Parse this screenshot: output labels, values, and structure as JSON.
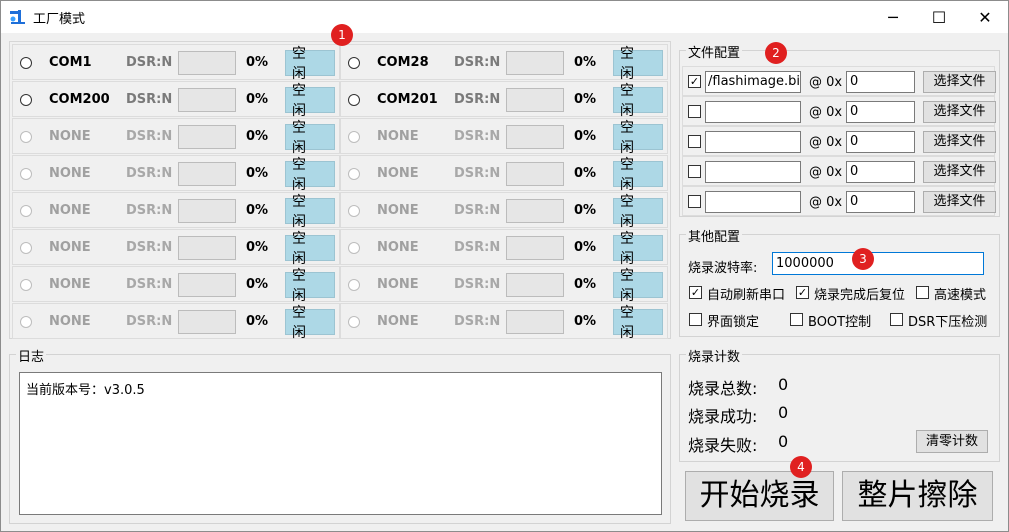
{
  "window": {
    "title": "工厂模式",
    "minimize": "─",
    "maximize": "☐",
    "close": "✕"
  },
  "ports": {
    "dsr_label": "DSR:N",
    "percent": "0%",
    "idle_label": "空 闲",
    "rows": [
      [
        {
          "name": "COM1",
          "enabled": true
        },
        {
          "name": "COM28",
          "enabled": true
        }
      ],
      [
        {
          "name": "COM200",
          "enabled": true
        },
        {
          "name": "COM201",
          "enabled": true
        }
      ],
      [
        {
          "name": "NONE",
          "enabled": false
        },
        {
          "name": "NONE",
          "enabled": false
        }
      ],
      [
        {
          "name": "NONE",
          "enabled": false
        },
        {
          "name": "NONE",
          "enabled": false
        }
      ],
      [
        {
          "name": "NONE",
          "enabled": false
        },
        {
          "name": "NONE",
          "enabled": false
        }
      ],
      [
        {
          "name": "NONE",
          "enabled": false
        },
        {
          "name": "NONE",
          "enabled": false
        }
      ],
      [
        {
          "name": "NONE",
          "enabled": false
        },
        {
          "name": "NONE",
          "enabled": false
        }
      ],
      [
        {
          "name": "NONE",
          "enabled": false
        },
        {
          "name": "NONE",
          "enabled": false
        }
      ]
    ]
  },
  "file_config": {
    "title": "文件配置",
    "at_label": "@ 0x",
    "choose_label": "选择文件",
    "files": [
      {
        "checked": true,
        "path": "/flashimage.bin",
        "addr": "0"
      },
      {
        "checked": false,
        "path": "",
        "addr": "0"
      },
      {
        "checked": false,
        "path": "",
        "addr": "0"
      },
      {
        "checked": false,
        "path": "",
        "addr": "0"
      },
      {
        "checked": false,
        "path": "",
        "addr": "0"
      }
    ]
  },
  "other_config": {
    "title": "其他配置",
    "baud_label": "烧录波特率:",
    "baud_value": "1000000",
    "options": {
      "auto_refresh": {
        "label": "自动刷新串口",
        "checked": true
      },
      "reset_after": {
        "label": "烧录完成后复位",
        "checked": true
      },
      "high_speed": {
        "label": "高速模式",
        "checked": false
      },
      "lock_ui": {
        "label": "界面锁定",
        "checked": false
      },
      "boot_ctrl": {
        "label": "BOOT控制",
        "checked": false
      },
      "dsr_detect": {
        "label": "DSR下压检测",
        "checked": false
      }
    }
  },
  "log": {
    "title": "日志",
    "text": "当前版本号：v3.0.5"
  },
  "stats": {
    "title": "烧录计数",
    "total_label": "烧录总数:",
    "total": "0",
    "success_label": "烧录成功:",
    "success": "0",
    "fail_label": "烧录失败:",
    "fail": "0",
    "clear_label": "清零计数"
  },
  "actions": {
    "start_label": "开始烧录",
    "erase_label": "整片擦除"
  },
  "badges": [
    "1",
    "2",
    "3",
    "4"
  ],
  "colors": {
    "idle_bg": "#add8e6",
    "badge": "#e02020"
  }
}
